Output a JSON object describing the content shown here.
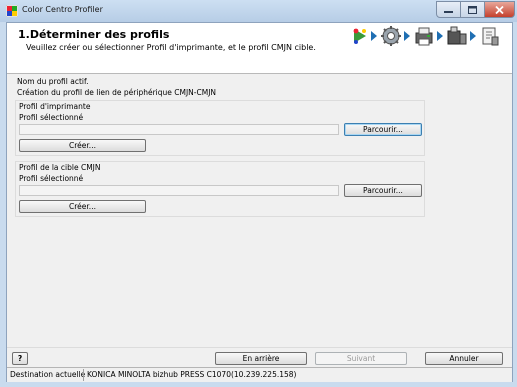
{
  "window": {
    "title": "Color Centro Profiler"
  },
  "header": {
    "title": "1.Déterminer des profils",
    "subtitle": "Veuillez créer ou sélectionner Profil d'imprimante, et le profil CMJN cible."
  },
  "body": {
    "active_profile_label": "Nom du profil actif.",
    "link_creation_label": "Création du profil de lien de périphérique CMJN-CMJN",
    "printer_group": {
      "title": "Profil d'imprimante",
      "selected_label": "Profil sélectionné",
      "selected_value": "",
      "browse_label": "Parcourir...",
      "create_label": "Créer..."
    },
    "target_group": {
      "title": "Profil de la cible CMJN",
      "selected_label": "Profil sélectionné",
      "selected_value": "",
      "browse_label": "Parcourir...",
      "create_label": "Créer..."
    }
  },
  "footer": {
    "help_label": "?",
    "back_label": "En arrière",
    "next_label": "Suivant",
    "cancel_label": "Annuler"
  },
  "status": {
    "destination_label": "Destination actuelle",
    "destination_value": "KONICA MINOLTA bizhub PRESS C1070(10.239.225.158)"
  },
  "steps": [
    "wizard-start-icon",
    "settings-gear-icon",
    "printer-measure-icon",
    "device-icon",
    "finish-icon"
  ],
  "colors": {
    "accent": "#3c7fb1",
    "close": "#c4402c",
    "frame": "#c9dbee"
  }
}
